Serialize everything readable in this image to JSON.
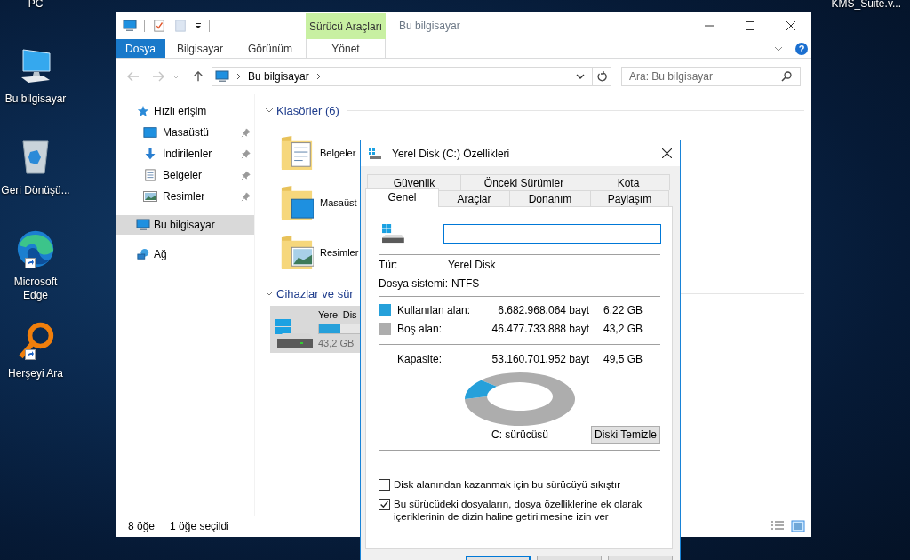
{
  "desktop": {
    "icons": [
      {
        "label": "PC",
        "kind": "none",
        "shortcut": false
      },
      {
        "label": "Bu bilgisayar",
        "kind": "computer",
        "shortcut": false
      },
      {
        "label": "Geri Dönüşü...",
        "kind": "recycle",
        "shortcut": false
      },
      {
        "label": "Microsoft Edge",
        "kind": "browser",
        "shortcut": true
      },
      {
        "label": "Herşeyi Ara",
        "kind": "magnifier",
        "shortcut": true
      }
    ],
    "corner_label": "KMS_Suite.v..."
  },
  "explorer": {
    "title": "Bu bilgisayar",
    "context_tab": "Sürücü Araçları",
    "ribbon_tabs": [
      {
        "label": "Dosya",
        "kind": "file"
      },
      {
        "label": "Bilgisayar",
        "kind": "tab"
      },
      {
        "label": "Görünüm",
        "kind": "tab"
      },
      {
        "label": "Yönet",
        "kind": "context"
      }
    ],
    "help": "?",
    "address": [
      "Bu bilgisayar"
    ],
    "search": {
      "placeholder": "Ara: Bu bilgisayar"
    },
    "nav": [
      {
        "label": "Hızlı erişim",
        "kind": "star",
        "selected": false,
        "children": [
          {
            "label": "Masaüstü",
            "kind": "desktop",
            "pinned": true,
            "selected": false
          },
          {
            "label": "İndirilenler",
            "kind": "download",
            "pinned": true,
            "selected": false
          },
          {
            "label": "Belgeler",
            "kind": "documents",
            "pinned": true,
            "selected": false
          },
          {
            "label": "Resimler",
            "kind": "pictures",
            "pinned": true,
            "selected": false
          }
        ]
      },
      {
        "label": "Bu bilgisayar",
        "kind": "computer",
        "selected": true
      },
      {
        "label": "Ağ",
        "kind": "network",
        "selected": false
      }
    ],
    "groups": [
      {
        "title": "Klasörler (6)",
        "kind": "folders",
        "items": [
          {
            "label": "Belgeler",
            "kind": "documents"
          },
          {
            "label": "Masaüst",
            "kind": "desktop"
          },
          {
            "label": "Resimler",
            "kind": "pictures"
          }
        ]
      },
      {
        "title": "Cihazlar ve sür",
        "kind": "drives",
        "items": [
          {
            "label": "Yerel Dis",
            "level": 0.126,
            "free": "43,2 GB",
            "selected": true
          }
        ]
      }
    ],
    "status": [
      "8 öğe",
      "1 öğe seçildi"
    ]
  },
  "dialog": {
    "title": "Yerel Disk (C:) Özellikleri",
    "tab_rows": [
      {
        "tabs": [
          {
            "label": "Güvenlik",
            "selected": false
          },
          {
            "label": "Önceki Sürümler",
            "selected": false
          },
          {
            "label": "Kota",
            "selected": false
          }
        ]
      },
      {
        "tabs": [
          {
            "label": "Genel",
            "selected": true
          },
          {
            "label": "Araçlar",
            "selected": false
          },
          {
            "label": "Donanım",
            "selected": false
          },
          {
            "label": "Paylaşım",
            "selected": false
          }
        ]
      }
    ],
    "info": [
      {
        "label": "Tür:",
        "value": "Yerel Disk"
      },
      {
        "label": "Dosya sistemi:",
        "value": "NTFS"
      }
    ],
    "space": [
      {
        "label": "Kullanılan alan:",
        "bytes": "6.682.968.064 bayt",
        "size": "6,22 GB",
        "color": "#26a0da"
      },
      {
        "label": "Boş alan:",
        "bytes": "46.477.733.888 bayt",
        "size": "43,2 GB",
        "color": "#adadad"
      }
    ],
    "capacity": {
      "label": "Kapasite:",
      "bytes": "53.160.701.952 bayt",
      "size": "49,5 GB"
    },
    "drive_label": "C: sürücüsü",
    "cleanup_button": "Diski Temizle",
    "options": [
      {
        "label": "Disk alanından kazanmak için bu sürücüyü sıkıştır",
        "checked": false
      },
      {
        "label": "Bu sürücüdeki dosyaların, dosya özelliklerine ek olarak içeriklerinin de dizin haline getirilmesine izin ver",
        "checked": true
      }
    ],
    "footer_buttons": [
      {
        "default": true
      },
      {
        "default": false
      },
      {
        "default": false
      }
    ]
  }
}
